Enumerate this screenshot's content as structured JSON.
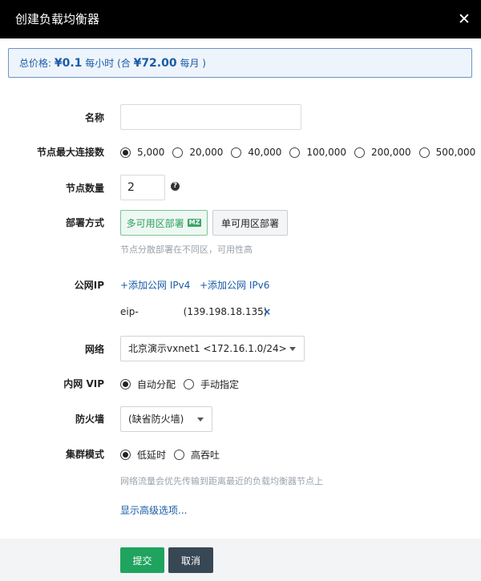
{
  "dialog": {
    "title": "创建负载均衡器",
    "close_icon": "close-icon"
  },
  "price": {
    "label": "总价格:",
    "hourly": "¥0.1",
    "hourly_unit": "每小时 (合",
    "monthly": "¥72.00",
    "monthly_unit": "每月 )"
  },
  "form": {
    "name": {
      "label": "名称",
      "value": "",
      "placeholder": ""
    },
    "max_connections": {
      "label": "节点最大连接数",
      "options": [
        "5,000",
        "20,000",
        "40,000",
        "100,000",
        "200,000",
        "500,000"
      ],
      "selected": "5,000"
    },
    "node_count": {
      "label": "节点数量",
      "value": "2",
      "help_icon": "question-circle-icon"
    },
    "deploy": {
      "label": "部署方式",
      "multi_zone": "多可用区部署",
      "multi_zone_badge": "MZ",
      "single_zone": "单可用区部署",
      "hint": "节点分散部署在不同区，可用性高"
    },
    "public_ip": {
      "label": "公网IP",
      "add_ipv4": "+添加公网 IPv4",
      "add_ipv6": "+添加公网 IPv6",
      "eip_name": "eip-",
      "eip_address": "(139.198.18.135)",
      "remove": "×"
    },
    "network": {
      "label": "网络",
      "value": "北京演示vxnet1 <172.16.1.0/24>"
    },
    "private_vip": {
      "label": "内网 VIP",
      "options": [
        "自动分配",
        "手动指定"
      ],
      "selected": "自动分配"
    },
    "firewall": {
      "label": "防火墙",
      "value": "(缺省防火墙)"
    },
    "cluster_mode": {
      "label": "集群模式",
      "options": [
        "低延时",
        "高吞吐"
      ],
      "selected": "低延时",
      "hint": "网络流量会优先传输到距离最近的负载均衡器节点上"
    },
    "advanced_link": "显示高级选项..."
  },
  "footer": {
    "submit": "提交",
    "cancel": "取消"
  }
}
